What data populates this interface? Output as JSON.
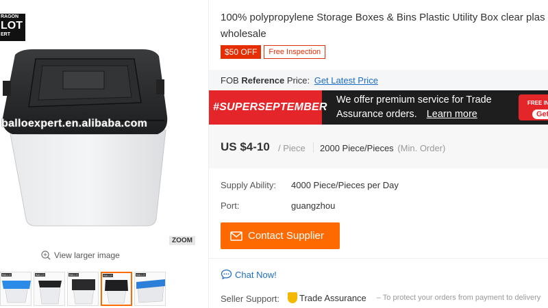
{
  "gallery": {
    "logo_line1": "RAGON",
    "logo_line2": "LOT",
    "logo_line3": "ERT",
    "watermark": "balloexpert.en.alibaba.com",
    "zoom_label": "ZOOM",
    "view_larger": "View larger image",
    "thumb_tags": [
      "BALLO",
      "BALLO",
      "BALLO",
      "BALLO",
      "BALLO"
    ]
  },
  "product": {
    "title_line1": "100% polypropylene Storage Boxes & Bins Plastic Utility Box clear plas",
    "title_line2": "wholesale",
    "discount_badge": "$50 OFF",
    "inspection_badge": "Free Inspection"
  },
  "fob": {
    "prefix": "FOB",
    "bold": "Reference",
    "suffix": "Price:",
    "link": "Get Latest Price"
  },
  "banner": {
    "tag": "#SUPERSEPTEMBER",
    "line1": "We offer premium service for Trade",
    "line2": "Assurance orders.",
    "learn_more": "Learn more",
    "promo_text": "FREE IN",
    "promo_button": "Get"
  },
  "pricing": {
    "price": "US $4-10",
    "unit": "/ Piece",
    "moq": "2000 Piece/Pieces",
    "moq_note": "(Min. Order)"
  },
  "info": {
    "supply_label": "Supply Ability:",
    "supply_value": "4000 Piece/Pieces per Day",
    "port_label": "Port:",
    "port_value": "guangzhou"
  },
  "actions": {
    "contact_supplier": "Contact Supplier",
    "chat_now": "Chat Now!"
  },
  "support": {
    "label": "Seller Support:",
    "trade_assurance": "Trade Assurance",
    "note": "– To protect your orders from payment to delivery"
  },
  "colors": {
    "accent": "#ff6a00",
    "link": "#1c6cc6",
    "promo_red": "#e4262a",
    "banner_dark": "#1e1e1e"
  }
}
